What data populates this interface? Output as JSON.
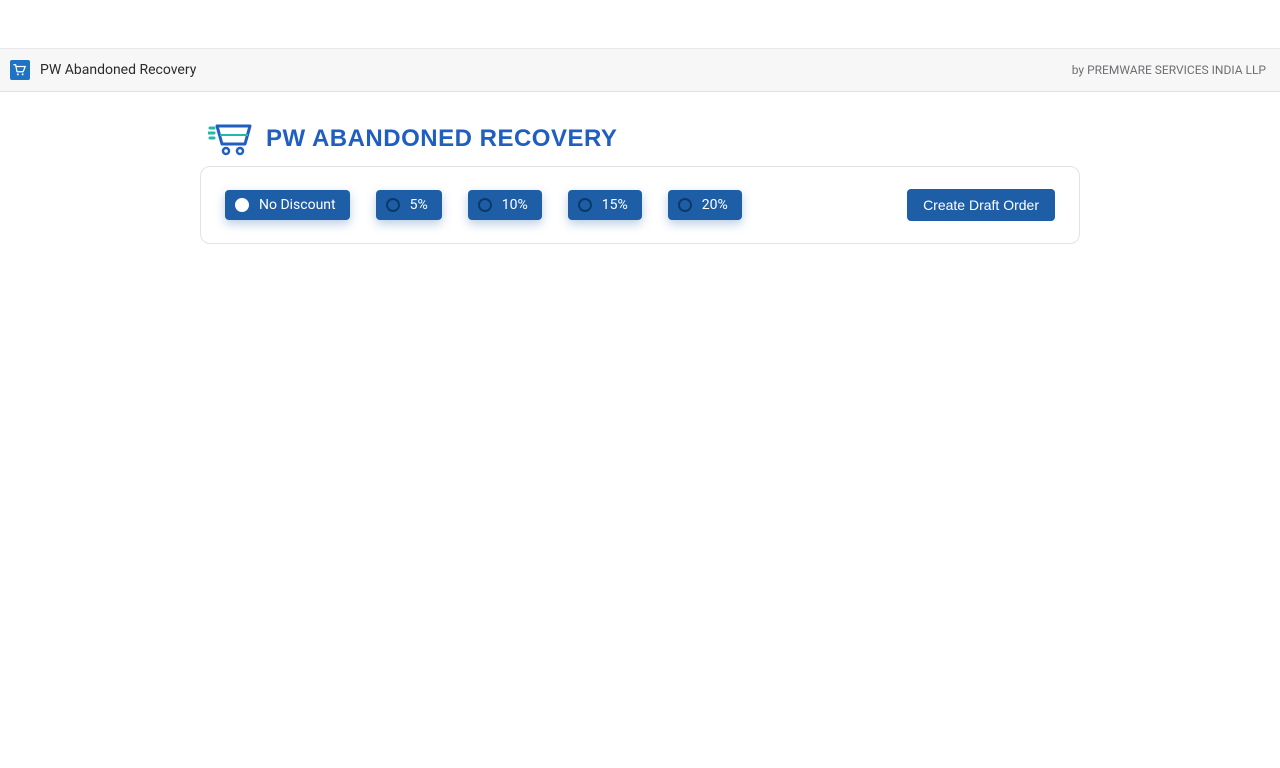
{
  "topbar": {
    "title": "PW Abandoned Recovery",
    "byline": "by PREMWARE SERVICES INDIA LLP"
  },
  "logo": {
    "text": "PW ABANDONED RECOVERY"
  },
  "discounts": {
    "options": [
      {
        "label": "No Discount",
        "selected": true
      },
      {
        "label": "5%",
        "selected": false
      },
      {
        "label": "10%",
        "selected": false
      },
      {
        "label": "15%",
        "selected": false
      },
      {
        "label": "20%",
        "selected": false
      }
    ]
  },
  "actions": {
    "create_draft_label": "Create Draft Order"
  }
}
